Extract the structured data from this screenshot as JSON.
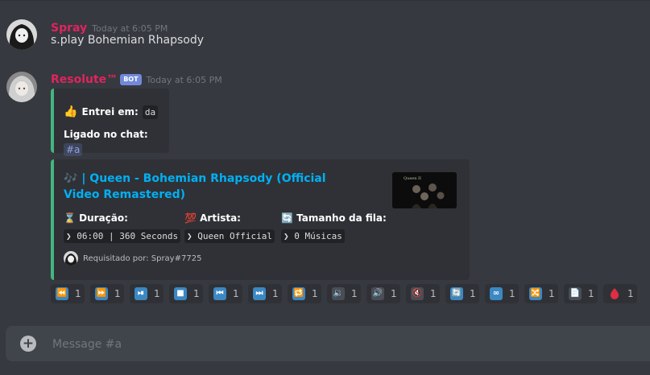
{
  "messages": [
    {
      "author": "Spray",
      "timestamp": "Today at 6:05 PM",
      "content": "s.play Bohemian Rhapsody"
    },
    {
      "author": "Resolute™",
      "badge": "BOT",
      "timestamp": "Today at 6:05 PM"
    }
  ],
  "embed1": {
    "joined_emoji": "👍",
    "joined_label": "Entrei em:",
    "joined_value": "da",
    "chat_label": "Ligado no chat:",
    "chat_value": "#a",
    "accent_color": "#43b581"
  },
  "embed2": {
    "title_emoji": "🎶",
    "title": "| Queen - Bohemian Rhapsody (Official Video Remastered)",
    "fields": [
      {
        "emoji": "⌛",
        "name": "Duração:",
        "value": "❯ 06:00 | 360 Seconds"
      },
      {
        "emoji": "💯",
        "name": "Artista:",
        "value": "❯ Queen Official"
      },
      {
        "emoji": "🔄",
        "name": "Tamanho da fila:",
        "value": "❯ 0 Músicas"
      }
    ],
    "footer": "Requisitado por: Spray#7725"
  },
  "reactions": [
    {
      "icon": "rewind-icon",
      "glyph": "⏪",
      "color": "#3b88c3",
      "count": "1"
    },
    {
      "icon": "fast-forward-icon",
      "glyph": "⏩",
      "color": "#3b88c3",
      "count": "1"
    },
    {
      "icon": "play-pause-icon",
      "glyph": "⏯",
      "color": "#3b88c3",
      "count": "1"
    },
    {
      "icon": "stop-icon",
      "glyph": "■",
      "color": "#3b88c3",
      "count": "1"
    },
    {
      "icon": "previous-track-icon",
      "glyph": "⏮",
      "color": "#3b88c3",
      "count": "1"
    },
    {
      "icon": "next-track-icon",
      "glyph": "⏭",
      "color": "#3b88c3",
      "count": "1"
    },
    {
      "icon": "repeat-icon",
      "glyph": "🔁",
      "color": "#3b88c3",
      "count": "1"
    },
    {
      "icon": "volume-down-icon",
      "glyph": "🔉",
      "color": "#4a4d55",
      "count": "1"
    },
    {
      "icon": "volume-up-icon",
      "glyph": "🔊",
      "color": "#4a4d55",
      "count": "1"
    },
    {
      "icon": "mute-icon",
      "glyph": "🔇",
      "color": "#4a4d55",
      "count": "1"
    },
    {
      "icon": "refresh-icon",
      "glyph": "🔄",
      "color": "#3b88c3",
      "count": "1"
    },
    {
      "icon": "infinity-icon",
      "glyph": "∞",
      "color": "#3b88c3",
      "count": "1"
    },
    {
      "icon": "shuffle-icon",
      "glyph": "🔀",
      "color": "#3b88c3",
      "count": "1"
    },
    {
      "icon": "page-icon",
      "glyph": "📄",
      "color": "#4a4d55",
      "count": "1"
    },
    {
      "icon": "drop-of-blood-icon",
      "glyph": "🩸",
      "color": "#2f3136",
      "count": "1"
    }
  ],
  "composer": {
    "placeholder": "Message #a"
  }
}
